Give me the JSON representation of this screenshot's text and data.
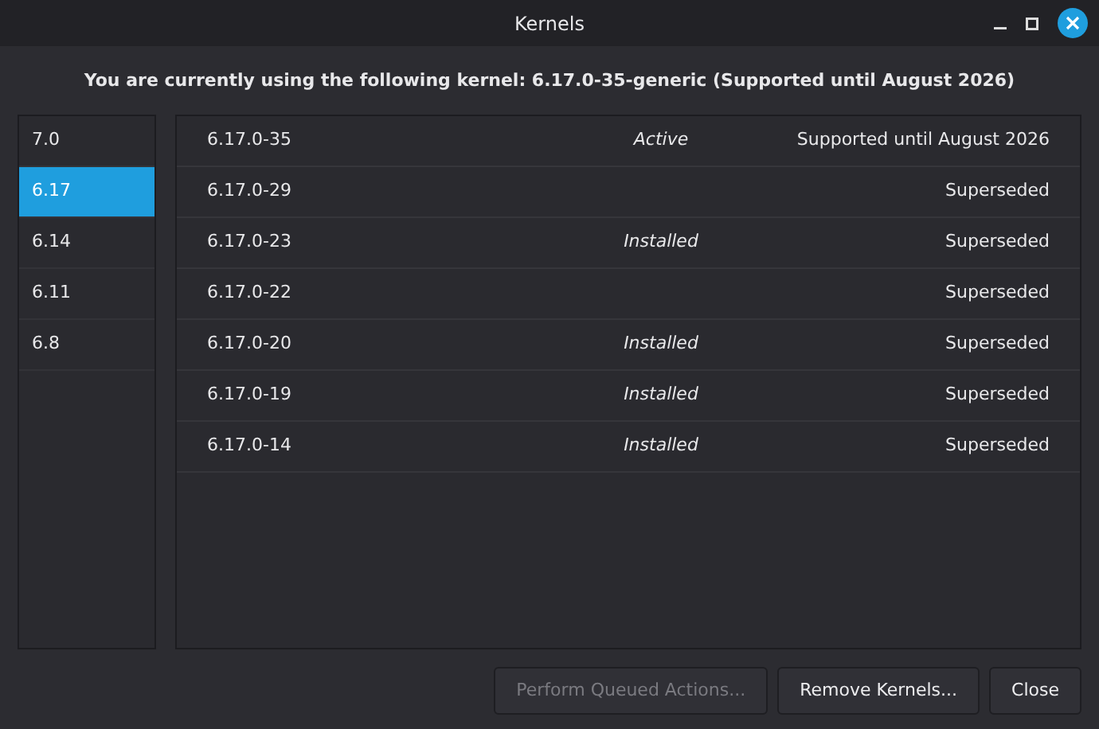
{
  "window": {
    "title": "Kernels"
  },
  "header": "You are currently using the following kernel: 6.17.0-35-generic (Supported until August 2026)",
  "versions": [
    {
      "label": "7.0",
      "selected": false
    },
    {
      "label": "6.17",
      "selected": true
    },
    {
      "label": "6.14",
      "selected": false
    },
    {
      "label": "6.11",
      "selected": false
    },
    {
      "label": "6.8",
      "selected": false
    }
  ],
  "kernels": [
    {
      "name": "6.17.0-35",
      "status": "Active",
      "support": "Supported until August 2026"
    },
    {
      "name": "6.17.0-29",
      "support": "Superseded"
    },
    {
      "name": "6.17.0-23",
      "status": "Installed",
      "support": "Superseded"
    },
    {
      "name": "6.17.0-22",
      "support": "Superseded"
    },
    {
      "name": "6.17.0-20",
      "status": "Installed",
      "support": "Superseded"
    },
    {
      "name": "6.17.0-19",
      "status": "Installed",
      "support": "Superseded"
    },
    {
      "name": "6.17.0-14",
      "status": "Installed",
      "support": "Superseded"
    }
  ],
  "buttons": [
    {
      "label": "Perform Queued Actions...",
      "disabled": true
    },
    {
      "label": "Remove Kernels...",
      "disabled": false
    },
    {
      "label": "Close",
      "disabled": false
    }
  ]
}
